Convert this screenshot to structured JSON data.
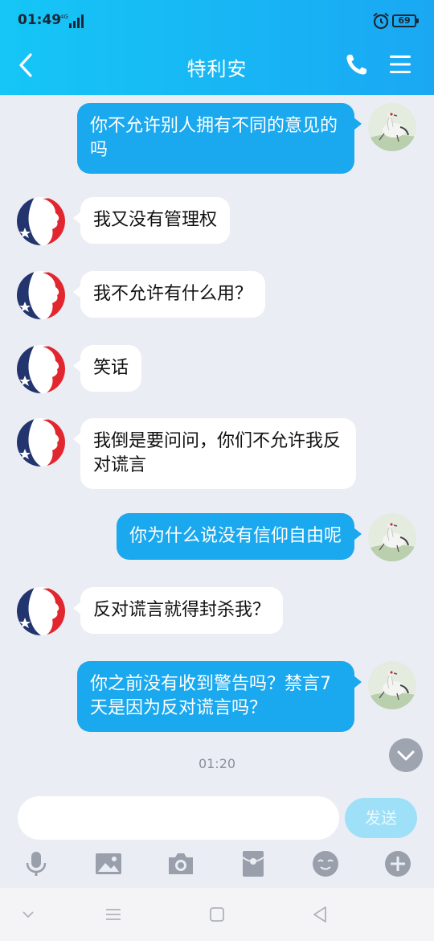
{
  "status_bar": {
    "time": "01:49",
    "network": "4G",
    "battery": "69"
  },
  "header": {
    "title": "特利安"
  },
  "messages": [
    {
      "from": "me",
      "text": "你不允许别人拥有不同的意见的吗"
    },
    {
      "from": "other",
      "text": "我又没有管理权"
    },
    {
      "from": "other",
      "text": "我不允许有什么用？"
    },
    {
      "from": "other",
      "text": "笑话"
    },
    {
      "from": "other",
      "text": "我倒是要问问，你们不允许我反对谎言"
    },
    {
      "from": "me",
      "text": "你为什么说没有信仰自由呢"
    },
    {
      "from": "other",
      "text": "反对谎言就得封杀我？"
    },
    {
      "from": "me",
      "text": "你之前没有收到警告吗？禁言7天是因为反对谎言吗？"
    }
  ],
  "timestamp": "01:20",
  "composer": {
    "placeholder": "",
    "value": "",
    "send_label": "发送"
  },
  "toolbar": [
    "microphone-icon",
    "image-icon",
    "camera-icon",
    "red-packet-icon",
    "emoji-icon",
    "plus-icon"
  ],
  "colors": {
    "header_start": "#15c6f6",
    "header_end": "#1aa8f3",
    "outgoing_bubble": "#1aa8ee",
    "incoming_bubble": "#ffffff",
    "chat_background": "#ebedf4"
  }
}
